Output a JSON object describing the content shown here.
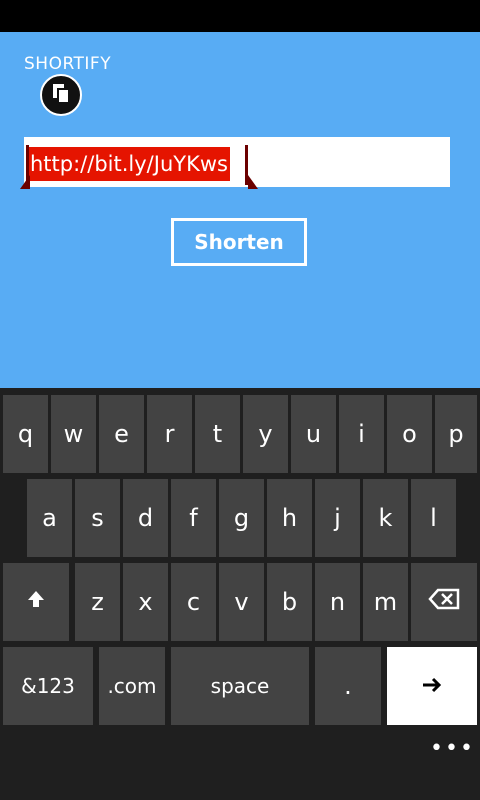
{
  "app": {
    "title": "SHORTIFY"
  },
  "paste_button": {
    "icon": "paste-icon"
  },
  "url_input": {
    "value": "http://bit.ly/JuYKws",
    "selection_color": "#e51400"
  },
  "shorten_button": {
    "label": "Shorten"
  },
  "keyboard": {
    "row1": [
      "q",
      "w",
      "e",
      "r",
      "t",
      "y",
      "u",
      "i",
      "o",
      "p"
    ],
    "row2": [
      "a",
      "s",
      "d",
      "f",
      "g",
      "h",
      "j",
      "k",
      "l"
    ],
    "row3": [
      "z",
      "x",
      "c",
      "v",
      "b",
      "n",
      "m"
    ],
    "shift_icon": "shift-arrow-icon",
    "backspace_icon": "backspace-icon",
    "symbols_label": "&123",
    "dotcom_label": ".com",
    "space_label": "space",
    "period_label": ".",
    "enter_icon": "arrow-right-icon",
    "more_label": "•••"
  },
  "colors": {
    "app_background": "#58acf4",
    "keyboard_background": "#1f1f1f",
    "key_background": "#434343"
  }
}
